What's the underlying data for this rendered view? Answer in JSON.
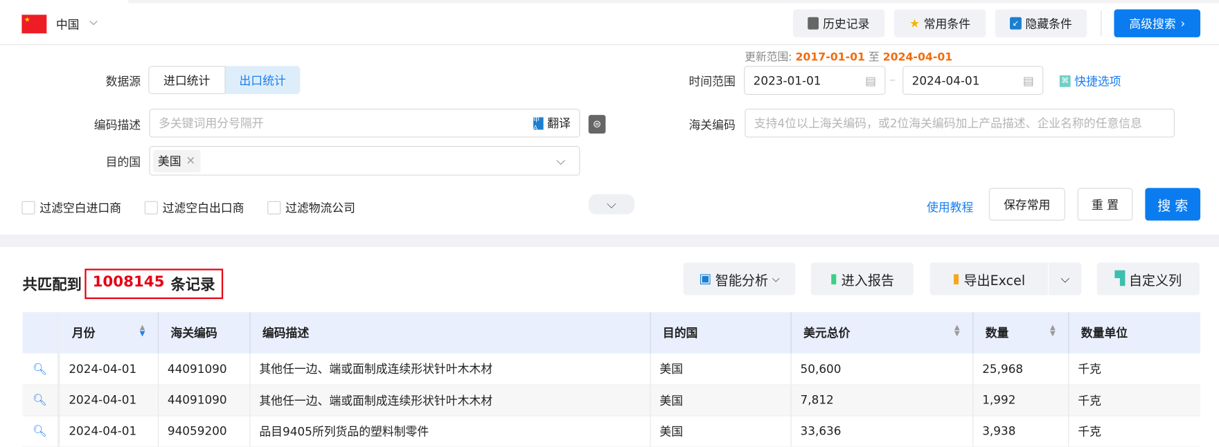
{
  "header": {
    "country": "中国",
    "buttons": {
      "history": "历史记录",
      "favorites": "常用条件",
      "hide": "隐藏条件",
      "advanced": "高级搜索"
    }
  },
  "form": {
    "update_range_label": "更新范围:",
    "update_from": "2017-01-01",
    "update_to_sep": "至",
    "update_to": "2024-04-01",
    "datasource_label": "数据源",
    "datasource_options": [
      "进口统计",
      "出口统计"
    ],
    "datasource_selected": "出口统计",
    "time_label": "时间范围",
    "date_from": "2023-01-01",
    "date_to": "2024-04-01",
    "quick_options": "快捷选项",
    "desc_label": "编码描述",
    "desc_placeholder": "多关键词用分号隔开",
    "translate": "翻译",
    "hs_label": "海关编码",
    "hs_placeholder": "支持4位以上海关编码，或2位海关编码加上产品描述、企业名称的任意信息",
    "dest_label": "目的国",
    "dest_tags": [
      "美国"
    ],
    "checkboxes": [
      "过滤空白进口商",
      "过滤空白出口商",
      "过滤物流公司"
    ],
    "tutorial": "使用教程",
    "save": "保存常用",
    "reset": "重 置",
    "search": "搜 索"
  },
  "results": {
    "prefix": "共匹配到",
    "count": "1008145",
    "suffix": "条记录",
    "buttons": {
      "analysis": "智能分析",
      "report": "进入报告",
      "export": "导出Excel",
      "columns": "自定义列"
    },
    "columns": [
      "月份",
      "海关编码",
      "编码描述",
      "目的国",
      "美元总价",
      "数量",
      "数量单位"
    ],
    "rows": [
      [
        "2024-04-01",
        "44091090",
        "其他任一边、端或面制成连续形状针叶木木材",
        "美国",
        "50,600",
        "25,968",
        "千克"
      ],
      [
        "2024-04-01",
        "44091090",
        "其他任一边、端或面制成连续形状针叶木木材",
        "美国",
        "7,812",
        "1,992",
        "千克"
      ],
      [
        "2024-04-01",
        "94059200",
        "品目9405所列货品的塑料制零件",
        "美国",
        "33,636",
        "3,938",
        "千克"
      ]
    ]
  },
  "colors": {
    "accent": "#0a7cf0",
    "highlight": "#f26c0d",
    "count_red": "#e60012"
  }
}
